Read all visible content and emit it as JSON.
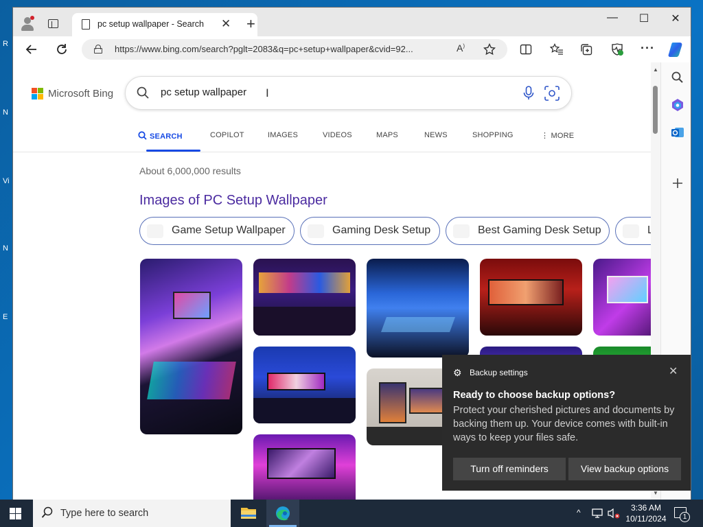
{
  "desktop": {
    "labels": [
      "R",
      "N",
      "Vi",
      "N",
      "E"
    ]
  },
  "browser": {
    "tab_title": "pc setup wallpaper - Search",
    "tab_close": "✕",
    "new_tab": "+",
    "window_controls": {
      "minimize": "—",
      "maximize": "☐",
      "close": "✕"
    },
    "url": "https://www.bing.com/search?pglt=2083&q=pc+setup+wallpaper&cvid=92...",
    "read_aloud_label": "A"
  },
  "bing": {
    "logo_text": "Microsoft Bing",
    "logo_colors": [
      "#f25022",
      "#7fba00",
      "#00a4ef",
      "#ffb900"
    ],
    "query": "pc setup wallpaper",
    "nav": [
      {
        "label": "SEARCH",
        "active": true
      },
      {
        "label": "COPILOT"
      },
      {
        "label": "IMAGES"
      },
      {
        "label": "VIDEOS"
      },
      {
        "label": "MAPS"
      },
      {
        "label": "NEWS"
      },
      {
        "label": "SHOPPING"
      },
      {
        "label": "⋮ MORE"
      }
    ],
    "results_count": "About 6,000,000 results",
    "images_heading": "Images of PC Setup Wallpaper",
    "pills": [
      "Game Setup Wallpaper",
      "Gaming Desk Setup",
      "Best Gaming Desk Setup",
      "L"
    ],
    "accent": "#174ae4",
    "heading_color": "#4b2ba0"
  },
  "notification": {
    "app": "Backup settings",
    "close": "✕",
    "title": "Ready to choose backup options?",
    "body": "Protect your cherished pictures and documents by backing them up. Your device comes with built-in ways to keep your files safe.",
    "buttons": [
      "Turn off reminders",
      "View backup options"
    ]
  },
  "taskbar": {
    "search_placeholder": "Type here to search",
    "time": "3:36 AM",
    "date": "10/11/2024",
    "notification_count": "1"
  }
}
